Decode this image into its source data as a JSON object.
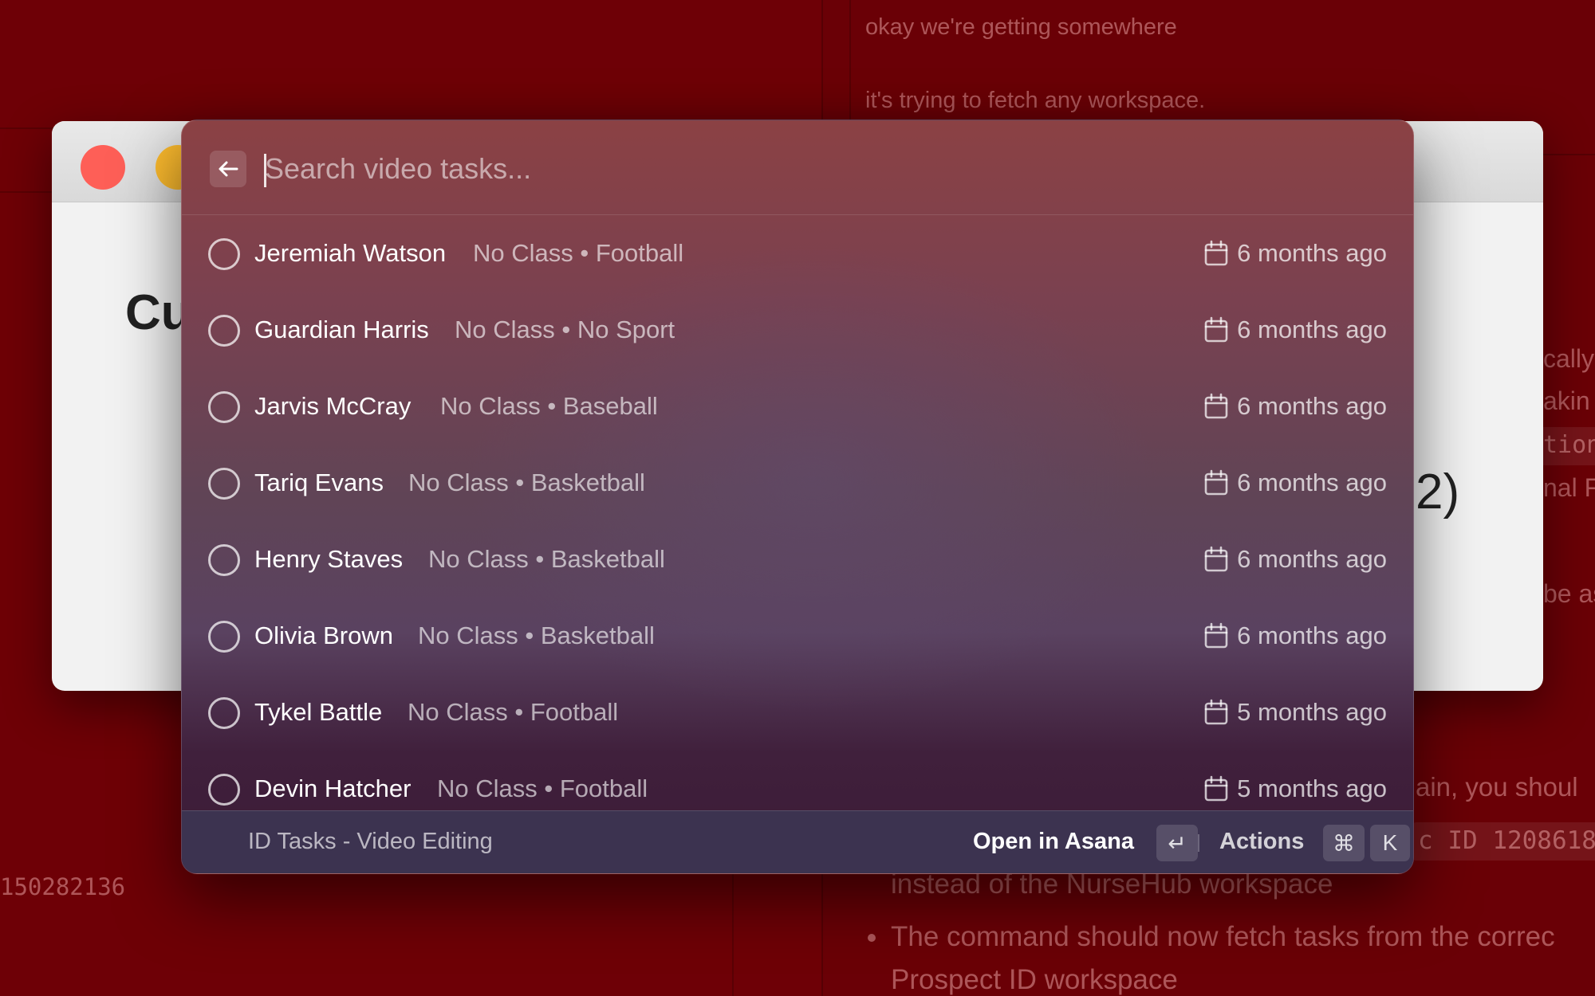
{
  "background": {
    "chat_lines": [
      "okay we're getting somewhere",
      "it's trying to fetch any workspace."
    ],
    "side_fragments": [
      "cally",
      "akin",
      "tion",
      "nal F",
      "be as"
    ],
    "bottom_fragments": {
      "line1": "ain, you shoul",
      "code": "c ID 1208618",
      "line2": "instead of the NurseHub workspace",
      "bullet_line1": "The command should now fetch tasks from the correc",
      "bullet_line2": "Prospect ID workspace"
    },
    "left_number": "150282136",
    "window_heading_fragment": "Cu",
    "window_right_fragment": "2)",
    "colors": {
      "background": "#6e0006",
      "traffic_red": "#fe5f57",
      "traffic_yellow": "#febc2e"
    }
  },
  "palette": {
    "back_icon": "arrow-left-icon",
    "search": {
      "placeholder": "Search video tasks...",
      "value": ""
    },
    "items": [
      {
        "name": "Jeremiah Watson",
        "meta": "No Class • Football",
        "date": "6 months ago",
        "icon": "calendar-icon"
      },
      {
        "name": "Guardian Harris",
        "meta": "No Class • No Sport",
        "date": "6 months ago",
        "icon": "calendar-icon"
      },
      {
        "name": "Jarvis McCray",
        "meta": "No Class • Baseball",
        "date": "6 months ago",
        "icon": "calendar-icon"
      },
      {
        "name": "Tariq Evans",
        "meta": "No Class • Basketball",
        "date": "6 months ago",
        "icon": "calendar-icon"
      },
      {
        "name": "Henry Staves",
        "meta": "No Class • Basketball",
        "date": "6 months ago",
        "icon": "calendar-icon"
      },
      {
        "name": "Olivia Brown",
        "meta": "No Class • Basketball",
        "date": "6 months ago",
        "icon": "calendar-icon"
      },
      {
        "name": "Tykel Battle",
        "meta": "No Class • Football",
        "date": "5 months ago",
        "icon": "calendar-icon"
      },
      {
        "name": "Devin Hatcher",
        "meta": "No Class • Football",
        "date": "5 months ago",
        "icon": "calendar-icon"
      }
    ],
    "footer": {
      "section_title": "ID Tasks - Video Editing",
      "primary_action": "Open in Asana",
      "primary_key": "↵",
      "actions_label": "Actions",
      "actions_keys": [
        "⌘",
        "K"
      ]
    }
  }
}
